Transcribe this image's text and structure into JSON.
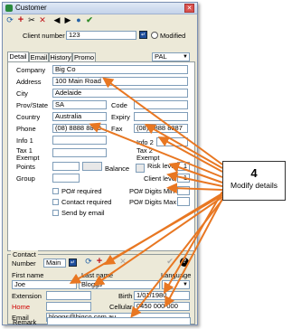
{
  "window": {
    "title": "Customer",
    "close_glyph": "✕"
  },
  "toolbar": {
    "refresh_glyph": "⟳",
    "add_glyph": "+",
    "cut_glyph": "✂",
    "delete_glyph": "✕",
    "prev_glyph": "◀",
    "next_glyph": "▶",
    "save_glyph": "●",
    "ok_glyph": "✔",
    "colors": {
      "add": "#c0161b",
      "delete": "#c0161b",
      "ok": "#2e8b27",
      "save": "#2563a8"
    }
  },
  "header": {
    "client_number_label": "Client number",
    "client_number_value": "123",
    "modified_label": "Modified"
  },
  "tabs": [
    {
      "label": "Detail"
    },
    {
      "label": "Email"
    },
    {
      "label": "History"
    },
    {
      "label": "Promo"
    }
  ],
  "price_level": {
    "value": "PAL"
  },
  "detail": {
    "company_label": "Company",
    "company_value": "Big Co",
    "address_label": "Address",
    "address_value": "100 Main Road",
    "city_label": "City",
    "city_value": "Adelaide",
    "state_label": "Prov/State",
    "state_value": "SA",
    "code_label": "Code",
    "country_label": "Country",
    "country_value": "Australia",
    "expiry_label": "Expiry",
    "phone_label": "Phone",
    "phone_value": "(08) 8888 8888",
    "fax_label": "Fax",
    "fax_value": "(08) 8888 8887",
    "info1_label": "Info 1",
    "info2_label": "Info 2",
    "tax1_label": "Tax 1 Exempt",
    "tax2_label": "Tax 2 Exempt",
    "points_label": "Points",
    "balance_label": "Balance",
    "risk_label": "Risk level",
    "risk_value": "1",
    "group_label": "Group",
    "client_level_label": "Client level",
    "client_level_value": "1",
    "po_digits_min_label": "PO# Digits Min",
    "po_digits_max_label": "PO# Digits Max",
    "po_required_label": "PO# required",
    "contact_required_label": "Contact required",
    "send_email_label": "Send by email"
  },
  "contact": {
    "group_label": "Contact",
    "number_label": "Number",
    "number_value": "Main",
    "first_name_label": "First name",
    "first_name_value": "Joe",
    "last_name_label": "Last name",
    "last_name_value": "Bloggs",
    "language_label": "Language",
    "extension_label": "Extension",
    "birth_label": "Birth",
    "birth_value": "1/01/1980",
    "home_label": "Home",
    "cellular_label": "Cellular",
    "cellular_value": "0450 000 000",
    "email_label": "Email",
    "email_value": "bloggs@bigco.com.au",
    "remark_label": "Remark",
    "home_label_color": "#d00000"
  },
  "callout": {
    "number": "4",
    "text": "Modify details",
    "arrow_color": "#e87722"
  }
}
